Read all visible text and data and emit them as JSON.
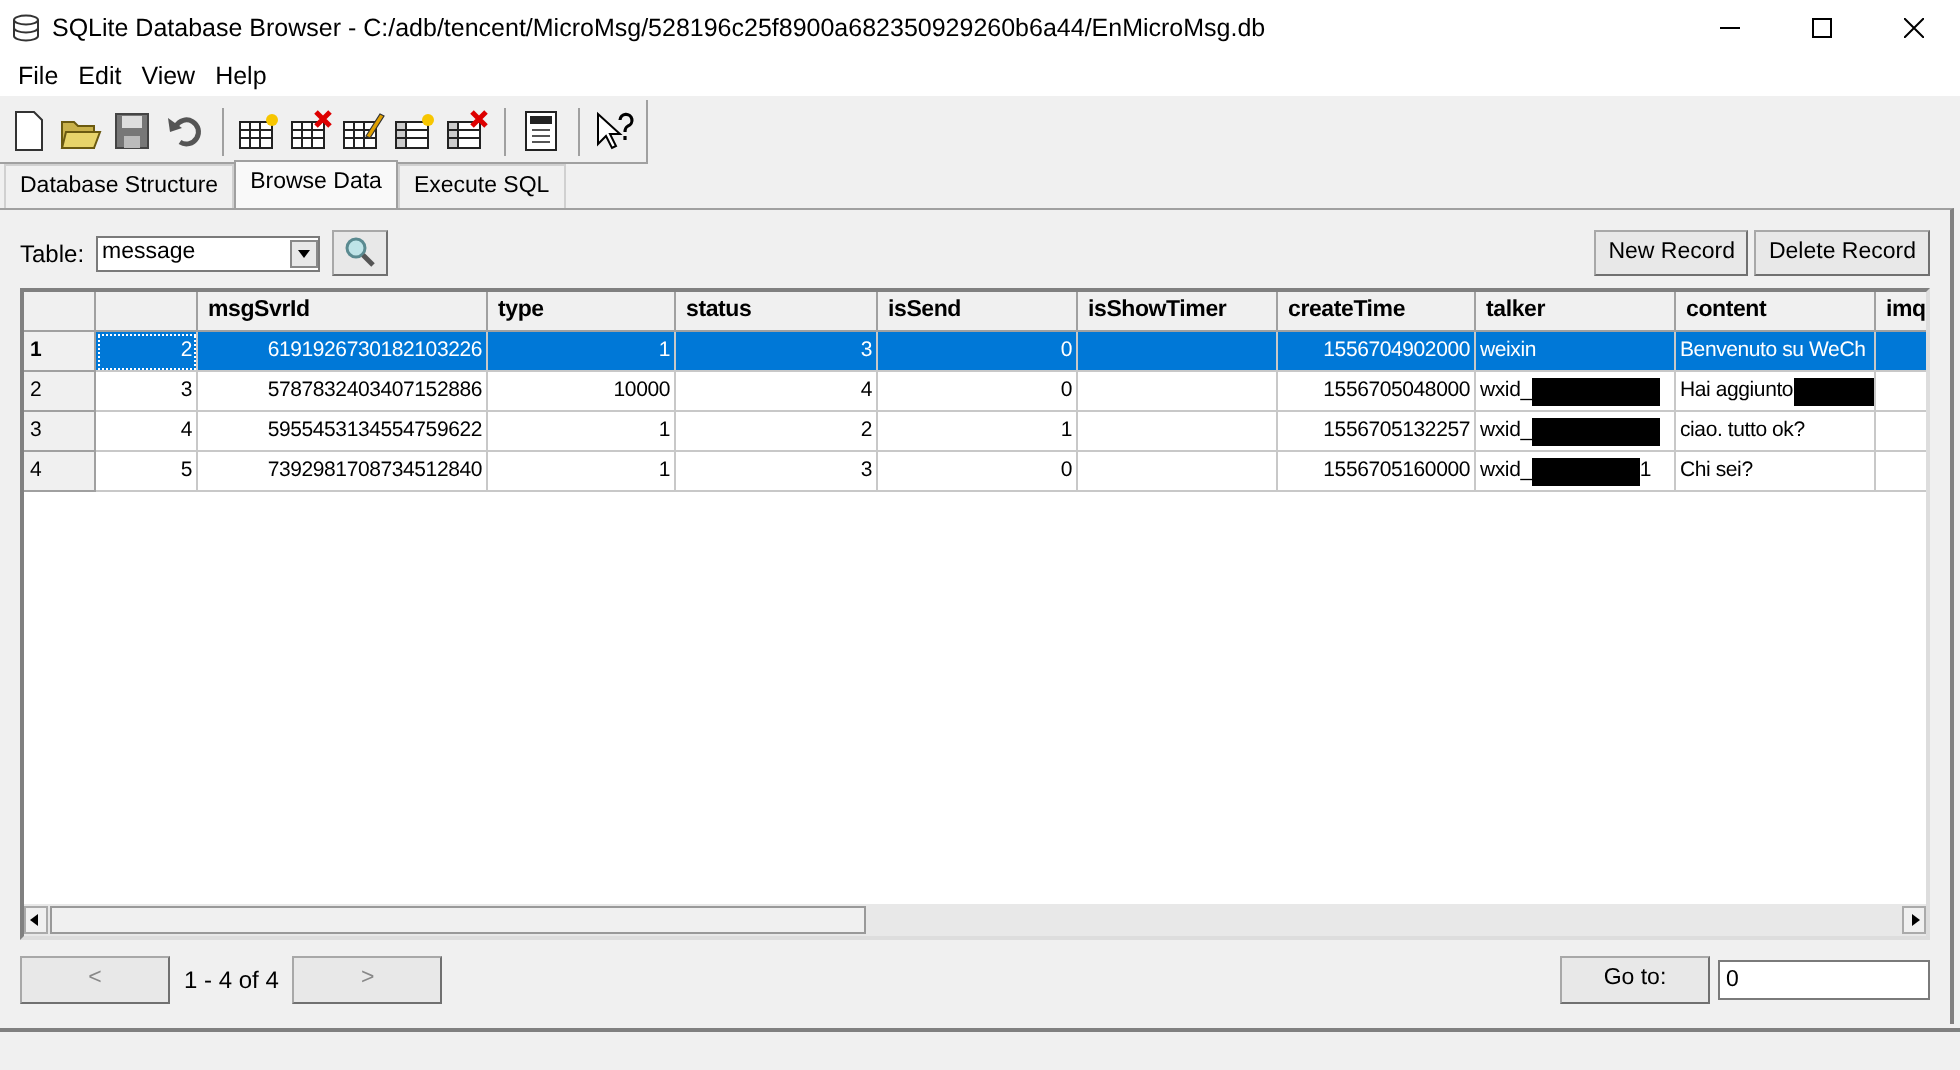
{
  "window": {
    "title": "SQLite Database Browser - C:/adb/tencent/MicroMsg/528196c25f8900a682350929260b6a44/EnMicroMsg.db"
  },
  "menu": [
    "File",
    "Edit",
    "View",
    "Help"
  ],
  "tabs": [
    {
      "label": "Database Structure",
      "selected": false
    },
    {
      "label": "Browse Data",
      "selected": true
    },
    {
      "label": "Execute SQL",
      "selected": false
    }
  ],
  "table_picker": {
    "label": "Table:",
    "value": "message"
  },
  "buttons": [
    "New Record",
    "Delete Record"
  ],
  "grid": {
    "columns": [
      "",
      "msgSvrId",
      "type",
      "status",
      "isSend",
      "isShowTimer",
      "createTime",
      "talker",
      "content",
      "imq"
    ],
    "rows": [
      {
        "header": "1",
        "selected": true,
        "cells": [
          {
            "text": "2"
          },
          {
            "text": "6191926730182103226"
          },
          {
            "text": "1"
          },
          {
            "text": "3"
          },
          {
            "text": "0"
          },
          {
            "text": ""
          },
          {
            "text": "1556704902000"
          },
          {
            "text": "weixin"
          },
          {
            "text": "Benvenuto su WeCh"
          }
        ]
      },
      {
        "header": "2",
        "selected": false,
        "cells": [
          {
            "text": "3"
          },
          {
            "text": "5787832403407152886"
          },
          {
            "text": "10000"
          },
          {
            "text": "4"
          },
          {
            "text": "0"
          },
          {
            "text": ""
          },
          {
            "text": "1556705048000"
          },
          {
            "text": "wxid_",
            "redacted": true
          },
          {
            "text": "Hai aggiunto",
            "redacted": true
          }
        ]
      },
      {
        "header": "3",
        "selected": false,
        "cells": [
          {
            "text": "4"
          },
          {
            "text": "5955453134554759622"
          },
          {
            "text": "1"
          },
          {
            "text": "2"
          },
          {
            "text": "1"
          },
          {
            "text": ""
          },
          {
            "text": "1556705132257"
          },
          {
            "text": "wxid_",
            "redacted": true
          },
          {
            "text": "ciao. tutto ok?"
          }
        ]
      },
      {
        "header": "4",
        "selected": false,
        "cells": [
          {
            "text": "5"
          },
          {
            "text": "7392981708734512840"
          },
          {
            "text": "1"
          },
          {
            "text": "3"
          },
          {
            "text": "0"
          },
          {
            "text": ""
          },
          {
            "text": "1556705160000"
          },
          {
            "text": "wxid_",
            "redacted": true,
            "suffix": "1"
          },
          {
            "text": "Chi sei?"
          }
        ]
      }
    ]
  },
  "pager": {
    "prev": "<",
    "range": "1 - 4 of 4",
    "next": ">",
    "goto_button": "Go to:",
    "goto_value": "0"
  }
}
